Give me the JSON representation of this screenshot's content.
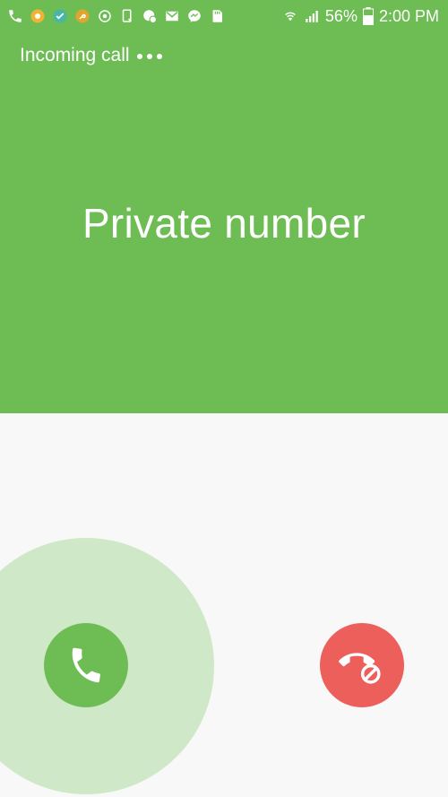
{
  "status_bar": {
    "battery_percent": "56%",
    "time": "2:00 PM",
    "left_icons": [
      "phone-icon",
      "sun-app-icon",
      "vpn-app-icon",
      "key-app-icon",
      "sync-icon",
      "screenshot-icon",
      "messenger-notification-icon",
      "gmail-icon",
      "facebook-messenger-icon",
      "sd-card-icon"
    ],
    "right_icons": [
      "wifi-icon",
      "signal-icon",
      "battery-icon"
    ]
  },
  "call": {
    "status_label": "Incoming call",
    "caller_name": "Private number"
  },
  "actions": {
    "answer_icon": "phone-answer-icon",
    "reject_icon": "phone-reject-icon"
  },
  "colors": {
    "header_green": "#6dbd54",
    "answer_green": "#6dbd54",
    "answer_halo": "#cfe8c7",
    "reject_red": "#ec5f5b",
    "background": "#f8f8f8"
  }
}
